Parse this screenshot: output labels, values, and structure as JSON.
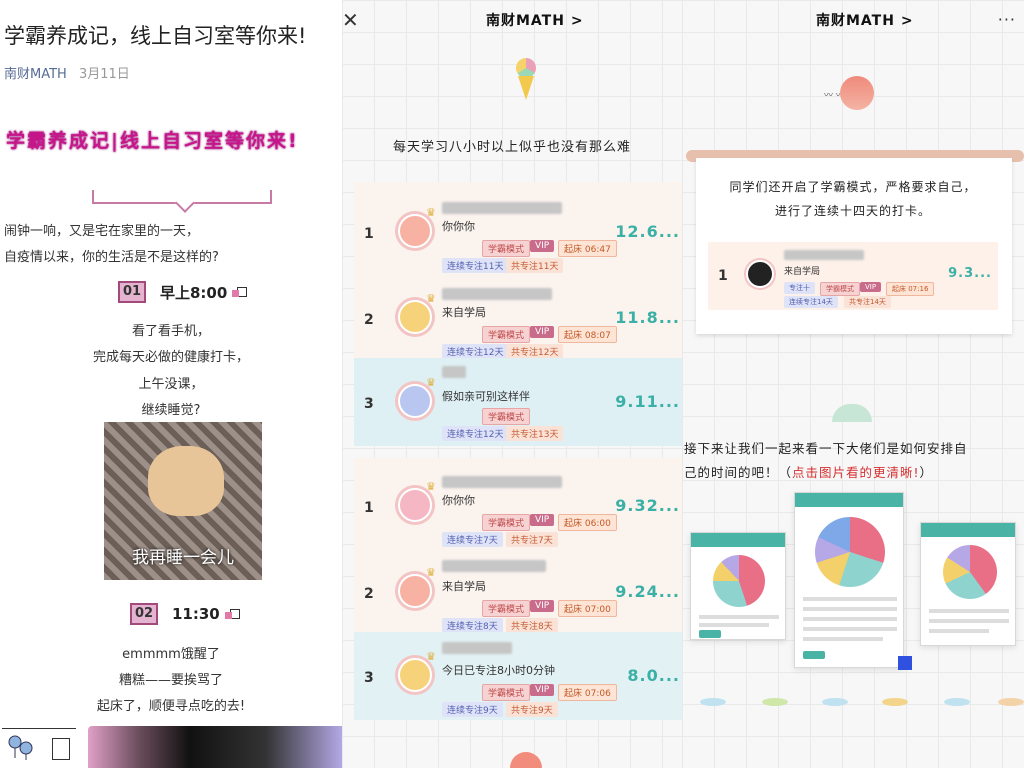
{
  "article": {
    "title": "学霸养成记，线上自习室等你来!",
    "account": "南财MATH",
    "date": "3月11日",
    "banner": "学霸养成记|线上自习室等你来!",
    "intro1": "闹钟一响，又是宅在家里的一天，",
    "intro2": "自疫情以来，你的生活是不是这样的?",
    "t1": {
      "num": "01",
      "label": "早上8:00"
    },
    "t1_lines": [
      "看了看手机，",
      "完成每天必做的健康打卡，",
      "上午没课，",
      "继续睡觉?"
    ],
    "meme_caption": "我再睡一会儿",
    "t2": {
      "num": "02",
      "label": "11:30"
    },
    "t2_lines": [
      "emmmm饿醒了",
      "糟糕——要挨骂了",
      "起床了，顺便寻点吃的去!"
    ]
  },
  "panel2": {
    "close": "✕",
    "mp_title": "南财MATH >",
    "heading": "每天学习八小时以上似乎也没有那么难",
    "labels": {
      "mode": "学霸模式",
      "vip": "VIP"
    },
    "board1": [
      {
        "rank": "1",
        "sub": "你你你",
        "up": "起床 06:47",
        "streak": "连续专注11天",
        "total": "共专注11天",
        "score": "12.6..."
      },
      {
        "rank": "2",
        "sub": "来自学局",
        "up": "起床 08:07",
        "streak": "连续专注12天",
        "total": "共专注12天",
        "score": "11.8..."
      },
      {
        "rank": "3",
        "sub": "假如亲可别这样伴",
        "up": "",
        "streak": "连续专注12天",
        "total": "共专注13天",
        "score": "9.11..."
      }
    ],
    "board2": [
      {
        "rank": "1",
        "sub": "你你你",
        "up": "起床 06:00",
        "streak": "连续专注7天",
        "total": "共专注7天",
        "score": "9.32..."
      },
      {
        "rank": "2",
        "sub": "来自学局",
        "up": "起床 07:00",
        "streak": "连续专注8天",
        "total": "共专注8天",
        "score": "9.24..."
      },
      {
        "rank": "3",
        "sub": "今日已专注8小时0分钟",
        "up": "起床 07:06",
        "streak": "连续专注9天",
        "total": "共专注9天",
        "score": "8.0..."
      }
    ]
  },
  "panel3": {
    "mp_title": "南财MATH >",
    "more": "···",
    "scroll_line1": "同学们还开启了学霸模式，严格要求自己，",
    "scroll_line2": "进行了连续十四天的打卡。",
    "mini": {
      "rank": "1",
      "sub": "来自学局",
      "mode": "学霸模式",
      "vip": "VIP",
      "up": "起床 07:16",
      "focus": "专注十",
      "streak": "连续专注14天",
      "total": "共专注14天",
      "score": "9.3..."
    },
    "para1": "接下来让我们一起来看一下大佬们是如何安排自",
    "para2a": "己的时间的吧！（",
    "para2b": "点击图片看的更清晰!",
    "para2c": "）"
  },
  "colors": {
    "accent_pink": "#c8158b",
    "teal": "#3bb0a6",
    "link_blue": "#576b95"
  }
}
